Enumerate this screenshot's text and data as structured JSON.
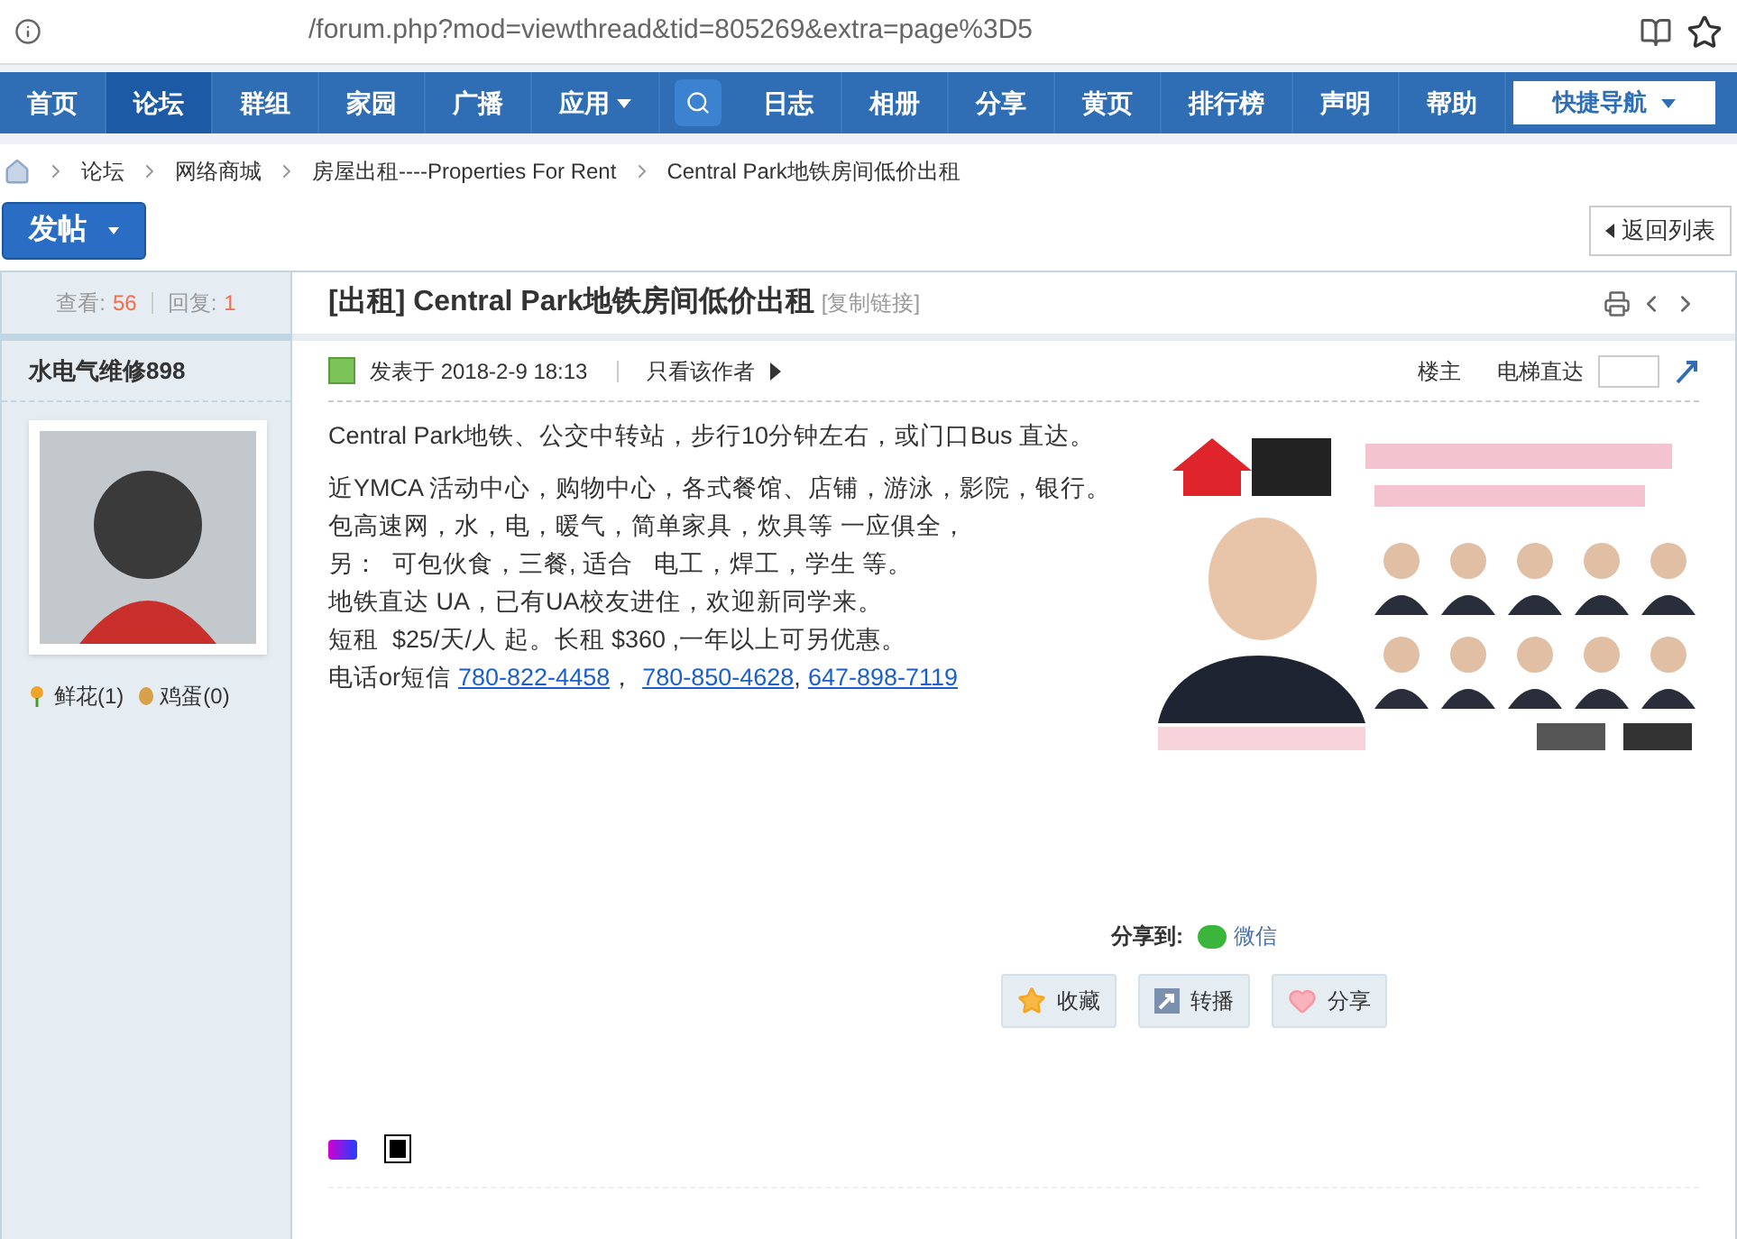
{
  "browser": {
    "url": "/forum.php?mod=viewthread&tid=805269&extra=page%3D5"
  },
  "nav": {
    "items": [
      {
        "label": "首页",
        "selected": false,
        "kind": "link"
      },
      {
        "label": "论坛",
        "selected": true,
        "kind": "link"
      },
      {
        "label": "群组",
        "selected": false,
        "kind": "link"
      },
      {
        "label": "家园",
        "selected": false,
        "kind": "link"
      },
      {
        "label": "广播",
        "selected": false,
        "kind": "link"
      },
      {
        "label": "应用",
        "selected": false,
        "kind": "menu"
      },
      {
        "kind": "search"
      },
      {
        "label": "日志",
        "selected": false,
        "kind": "link"
      },
      {
        "label": "相册",
        "selected": false,
        "kind": "link"
      },
      {
        "label": "分享",
        "selected": false,
        "kind": "link"
      },
      {
        "label": "黄页",
        "selected": false,
        "kind": "link"
      },
      {
        "label": "排行榜",
        "selected": false,
        "kind": "link"
      },
      {
        "label": "声明",
        "selected": false,
        "kind": "link"
      },
      {
        "label": "帮助",
        "selected": false,
        "kind": "link"
      }
    ],
    "quick_nav": "快捷导航"
  },
  "breadcrumb": [
    "论坛",
    "网络商城",
    "房屋出租----Properties For Rent",
    "Central Park地铁房间低价出租"
  ],
  "post_button": "发帖",
  "back_button": "返回列表",
  "stats": {
    "views_label": "查看:",
    "views": "56",
    "replies_label": "回复:",
    "replies": "1"
  },
  "thread": {
    "title": "[出租] Central Park地铁房间低价出租",
    "copy_link": "[复制链接]"
  },
  "author": {
    "name": "水电气维修898",
    "flowers": "鲜花(1)",
    "eggs": "鸡蛋(0)"
  },
  "post": {
    "posted": "发表于 2018-2-9 18:13",
    "author_only": "只看该作者",
    "floor": "楼主",
    "jump_label": "电梯直达",
    "paragraphs": [
      "Central Park地铁、公交中转站，步行10分钟左右，或门口Bus 直达。"
    ],
    "lines": [
      "近YMCA 活动中心，购物中心，各式餐馆、店铺，游泳，影院，银行。",
      "包高速网，水，电，暖气，简单家具，炊具等 一应俱全，",
      "另：  可包伙食，三餐, 适合   电工，焊工，学生 等。",
      "地铁直达 UA，已有UA校友进住，欢迎新同学来。",
      "短租  $25/天/人 起。长租 $360 ,一年以上可另优惠。"
    ],
    "phone_label": "电话or短信",
    "phones": [
      {
        "number": "780-822-4458",
        "after": "，"
      },
      {
        "number": "780-850-4628",
        "after": ","
      },
      {
        "number": "647-898-7119"
      }
    ],
    "share_label": "分享到:",
    "share_target": "微信",
    "actions": [
      {
        "kind": "star",
        "label": "收藏"
      },
      {
        "kind": "forward",
        "label": "转播"
      },
      {
        "kind": "heart",
        "label": "分享"
      }
    ]
  }
}
